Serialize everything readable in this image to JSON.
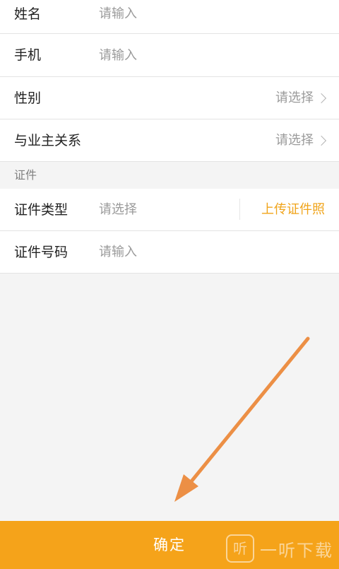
{
  "form": {
    "name": {
      "label": "姓名",
      "placeholder": "请输入"
    },
    "phone": {
      "label": "手机",
      "placeholder": "请输入"
    },
    "gender": {
      "label": "性别",
      "placeholder": "请选择"
    },
    "relation": {
      "label": "与业主关系",
      "placeholder": "请选择"
    }
  },
  "certificate": {
    "section_title": "证件",
    "type": {
      "label": "证件类型",
      "placeholder": "请选择",
      "upload_label": "上传证件照"
    },
    "number": {
      "label": "证件号码",
      "placeholder": "请输入"
    }
  },
  "footer": {
    "confirm_label": "确定"
  },
  "watermark": {
    "logo_text": "听",
    "text": "一听下载"
  },
  "colors": {
    "accent": "#f5a31a",
    "upload": "#f0a41a",
    "annotation_arrow": "#ec8f45"
  },
  "icons": {
    "chevron": "chevron-right-icon",
    "arrow": "annotation-arrow-icon"
  }
}
